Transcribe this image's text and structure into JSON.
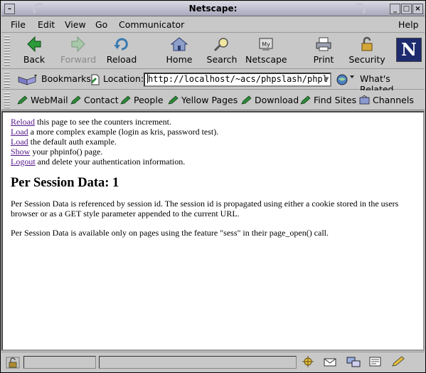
{
  "window": {
    "title": "Netscape:"
  },
  "menu": [
    "File",
    "Edit",
    "View",
    "Go",
    "Communicator",
    "Help"
  ],
  "nav": {
    "back": "Back",
    "forward": "Forward",
    "reload": "Reload",
    "home": "Home",
    "search": "Search",
    "netscape": "Netscape",
    "print": "Print",
    "security": "Security",
    "logo": "N"
  },
  "location": {
    "bookmarks": "Bookmarks",
    "label": "Location:",
    "url": "http://localhost/~acs/phpslash/phpl",
    "related": "What's Related"
  },
  "personal": [
    "WebMail",
    "Contact",
    "People",
    "Yellow Pages",
    "Download",
    "Find Sites",
    "Channels"
  ],
  "page": {
    "lines": [
      {
        "link": "Reload",
        "text": " this page to see the counters increment."
      },
      {
        "link": "Load",
        "text": " a more complex example (login as kris, password test)."
      },
      {
        "link": "Load",
        "text": " the default auth example."
      },
      {
        "link": "Show",
        "text": " your phpinfo() page."
      },
      {
        "link": "Logout",
        "text": " and delete your authentication information."
      }
    ],
    "heading": "Per Session Data: 1",
    "para1": "Per Session Data is referenced by session id. The session id is propagated using either a cookie stored in the users browser or as a GET style parameter appended to the current URL.",
    "para2": "Per Session Data is available only on pages using the feature \"sess\" in their page_open() call."
  },
  "colors": {
    "link": "#55188a",
    "chrome": "#c8c8c8",
    "logo_bg": "#1e2a6e"
  }
}
